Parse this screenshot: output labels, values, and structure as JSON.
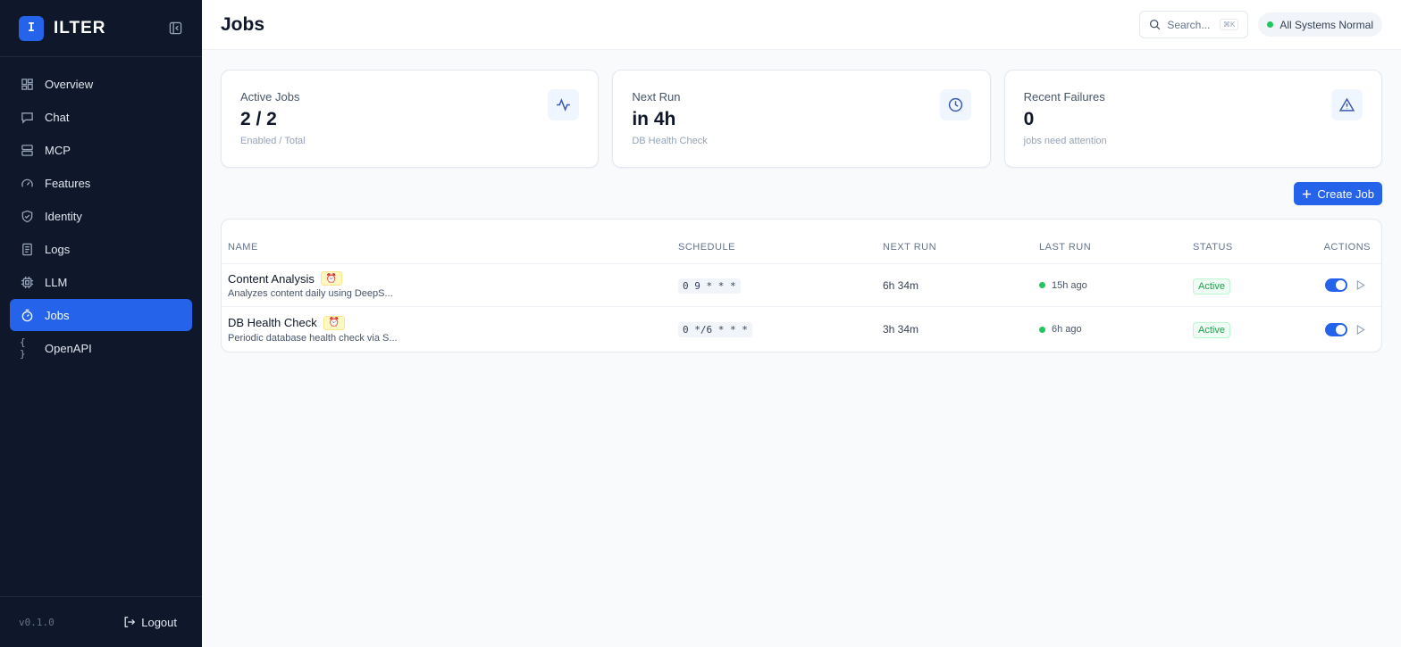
{
  "brand": {
    "logo_letter": "I",
    "name": "ILTER"
  },
  "sidebar": {
    "items": [
      {
        "label": "Overview",
        "icon": "grid-icon"
      },
      {
        "label": "Chat",
        "icon": "chat-icon"
      },
      {
        "label": "MCP",
        "icon": "server-icon"
      },
      {
        "label": "Features",
        "icon": "gauge-icon"
      },
      {
        "label": "Identity",
        "icon": "shield-icon"
      },
      {
        "label": "Logs",
        "icon": "log-icon"
      },
      {
        "label": "LLM",
        "icon": "chip-icon"
      },
      {
        "label": "Jobs",
        "icon": "timer-icon",
        "active": true
      },
      {
        "label": "OpenAPI",
        "icon": "braces-icon",
        "glyph": "{ }"
      }
    ],
    "version": "v0.1.0",
    "logout_label": "Logout"
  },
  "header": {
    "title": "Jobs",
    "search_placeholder": "Search...",
    "search_shortcut": "⌘K",
    "system_status": "All Systems Normal"
  },
  "stats": [
    {
      "label": "Active Jobs",
      "value": "2 / 2",
      "sub": "Enabled / Total",
      "icon": "activity-icon"
    },
    {
      "label": "Next Run",
      "value": "in 4h",
      "sub": "DB Health Check",
      "icon": "clock-icon"
    },
    {
      "label": "Recent Failures",
      "value": "0",
      "sub": "jobs need attention",
      "icon": "alert-triangle-icon"
    }
  ],
  "create_job_label": "Create Job",
  "table": {
    "columns": [
      "NAME",
      "SCHEDULE",
      "NEXT RUN",
      "LAST RUN",
      "STATUS",
      "ACTIONS"
    ],
    "rows": [
      {
        "name": "Content Analysis",
        "description": "Analyzes content daily using DeepS...",
        "schedule": "0 9 * * *",
        "next_run": "6h 34m",
        "last_run": "15h ago",
        "status": "Active",
        "enabled": true
      },
      {
        "name": "DB Health Check",
        "description": "Periodic database health check via S...",
        "schedule": "0 */6 * * *",
        "next_run": "3h 34m",
        "last_run": "6h ago",
        "status": "Active",
        "enabled": true
      }
    ]
  },
  "colors": {
    "sidebar_bg": "#0f172a",
    "accent": "#2563eb",
    "success": "#22c55e"
  }
}
